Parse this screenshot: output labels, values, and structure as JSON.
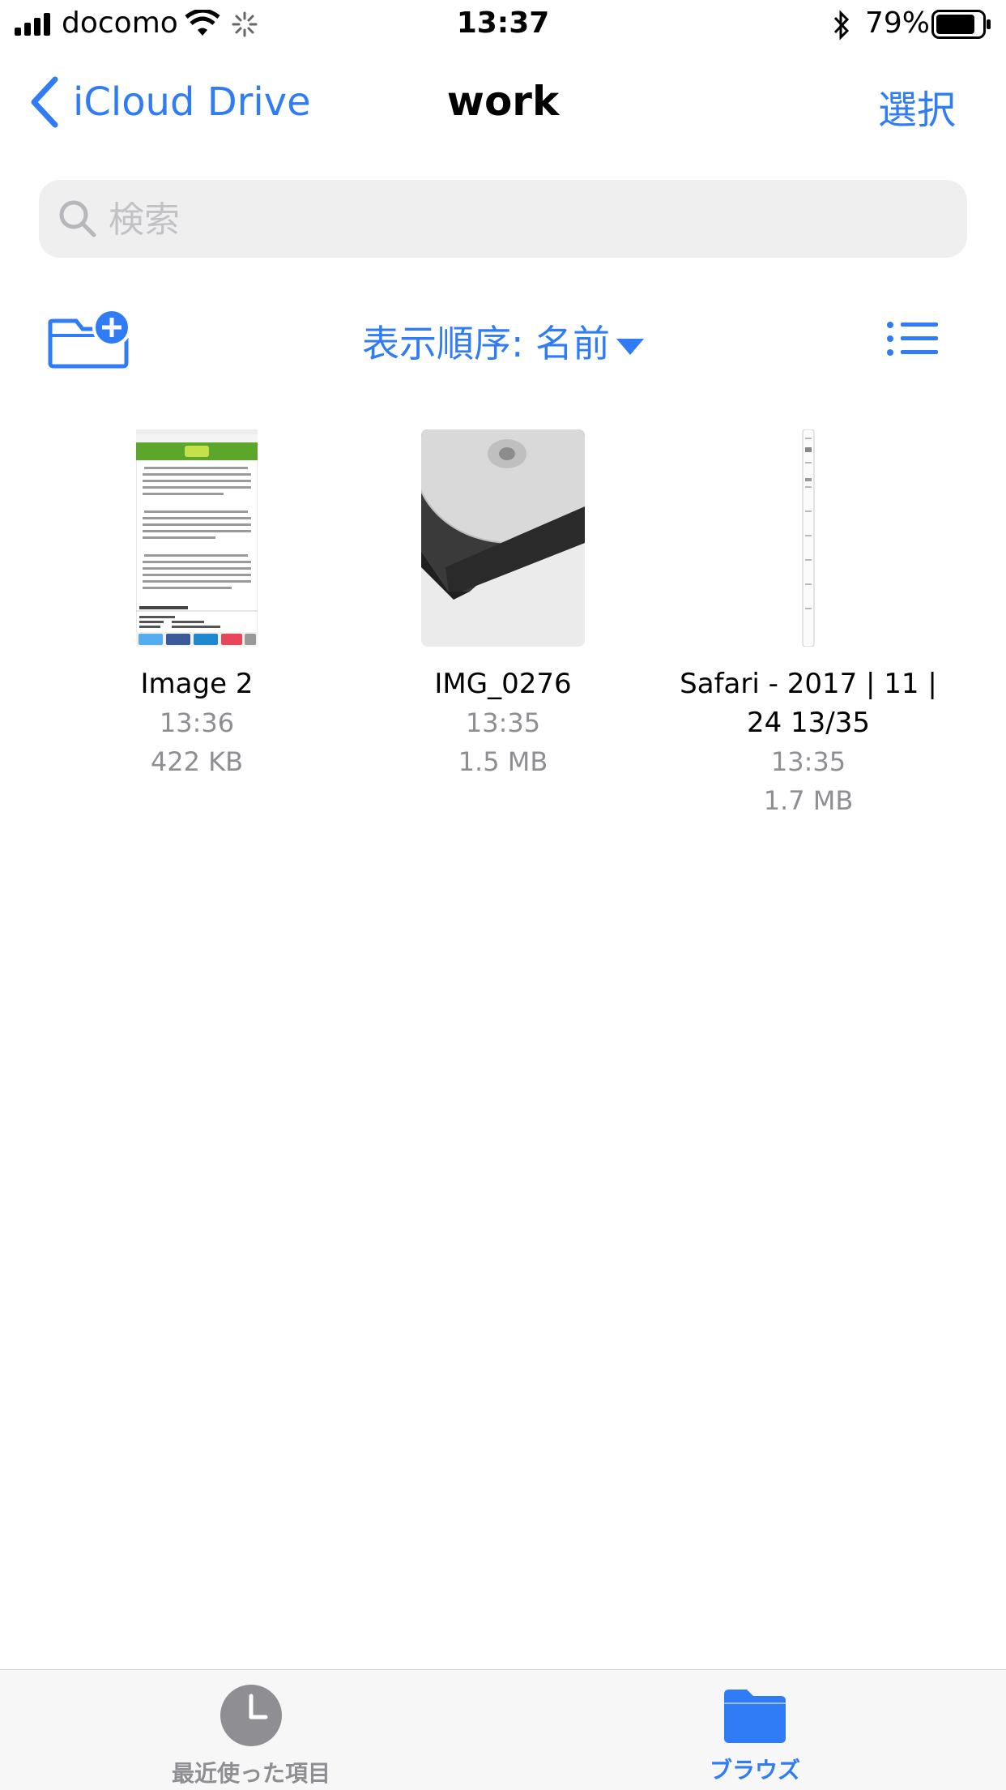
{
  "status_bar": {
    "carrier": "docomo",
    "time": "13:37",
    "battery": "79%"
  },
  "nav": {
    "back_label": "iCloud Drive",
    "title": "work",
    "select_label": "選択"
  },
  "search": {
    "placeholder": "検索"
  },
  "toolbar": {
    "sort_label": "表示順序: 名前"
  },
  "files": [
    {
      "name": "Image 2",
      "time": "13:36",
      "size": "422 KB"
    },
    {
      "name": "IMG_0276",
      "time": "13:35",
      "size": "1.5 MB"
    },
    {
      "name_line1": "Safari - 2017 | 11 |",
      "name_line2": "24 13/35",
      "time": "13:35",
      "size": "1.7 MB"
    }
  ],
  "tabs": [
    {
      "label": "最近使った項目"
    },
    {
      "label": "ブラウズ"
    }
  ],
  "colors": {
    "accent": "#2f7cf6",
    "secondary_text": "#8e8e93",
    "tab_inactive": "#8e8e93"
  }
}
